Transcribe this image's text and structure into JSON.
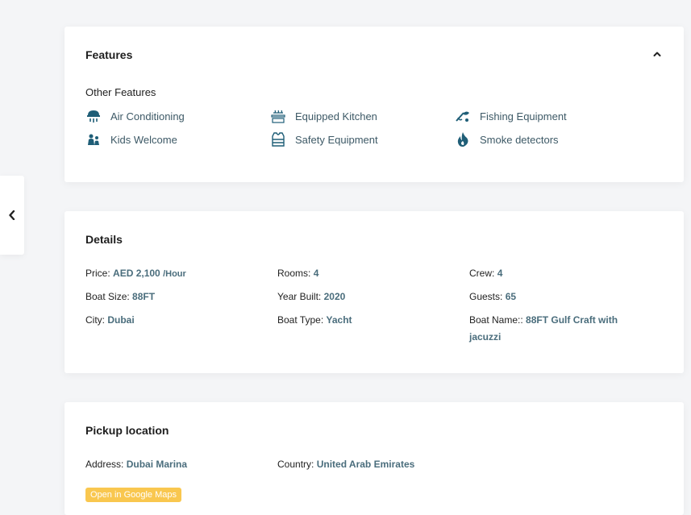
{
  "features": {
    "title": "Features",
    "subheading": "Other Features",
    "items": [
      {
        "label": "Air Conditioning",
        "icon": "air-conditioning-icon"
      },
      {
        "label": "Equipped Kitchen",
        "icon": "kitchen-icon"
      },
      {
        "label": "Fishing Equipment",
        "icon": "fishing-icon"
      },
      {
        "label": "Kids Welcome",
        "icon": "kids-icon"
      },
      {
        "label": "Safety Equipment",
        "icon": "life-vest-icon"
      },
      {
        "label": "Smoke detectors",
        "icon": "flame-icon"
      }
    ]
  },
  "details": {
    "title": "Details",
    "price_label": "Price:",
    "price_value": "AED 2,100",
    "price_unit": "/Hour",
    "rooms_label": "Rooms:",
    "rooms_value": "4",
    "crew_label": "Crew:",
    "crew_value": "4",
    "size_label": "Boat Size:",
    "size_value": "88FT",
    "year_label": "Year Built:",
    "year_value": "2020",
    "guests_label": "Guests:",
    "guests_value": "65",
    "city_label": "City:",
    "city_value": "Dubai",
    "type_label": "Boat Type:",
    "type_value": "Yacht",
    "name_label": "Boat Name::",
    "name_value": "88FT Gulf Craft with jacuzzi"
  },
  "pickup": {
    "title": "Pickup location",
    "address_label": "Address:",
    "address_value": "Dubai Marina",
    "country_label": "Country:",
    "country_value": "United Arab Emirates",
    "maps_button": "Open in Google Maps"
  },
  "colors": {
    "accent": "#4a6d7c",
    "icon": "#1f5e77",
    "maps_button": "#f9c74f"
  }
}
